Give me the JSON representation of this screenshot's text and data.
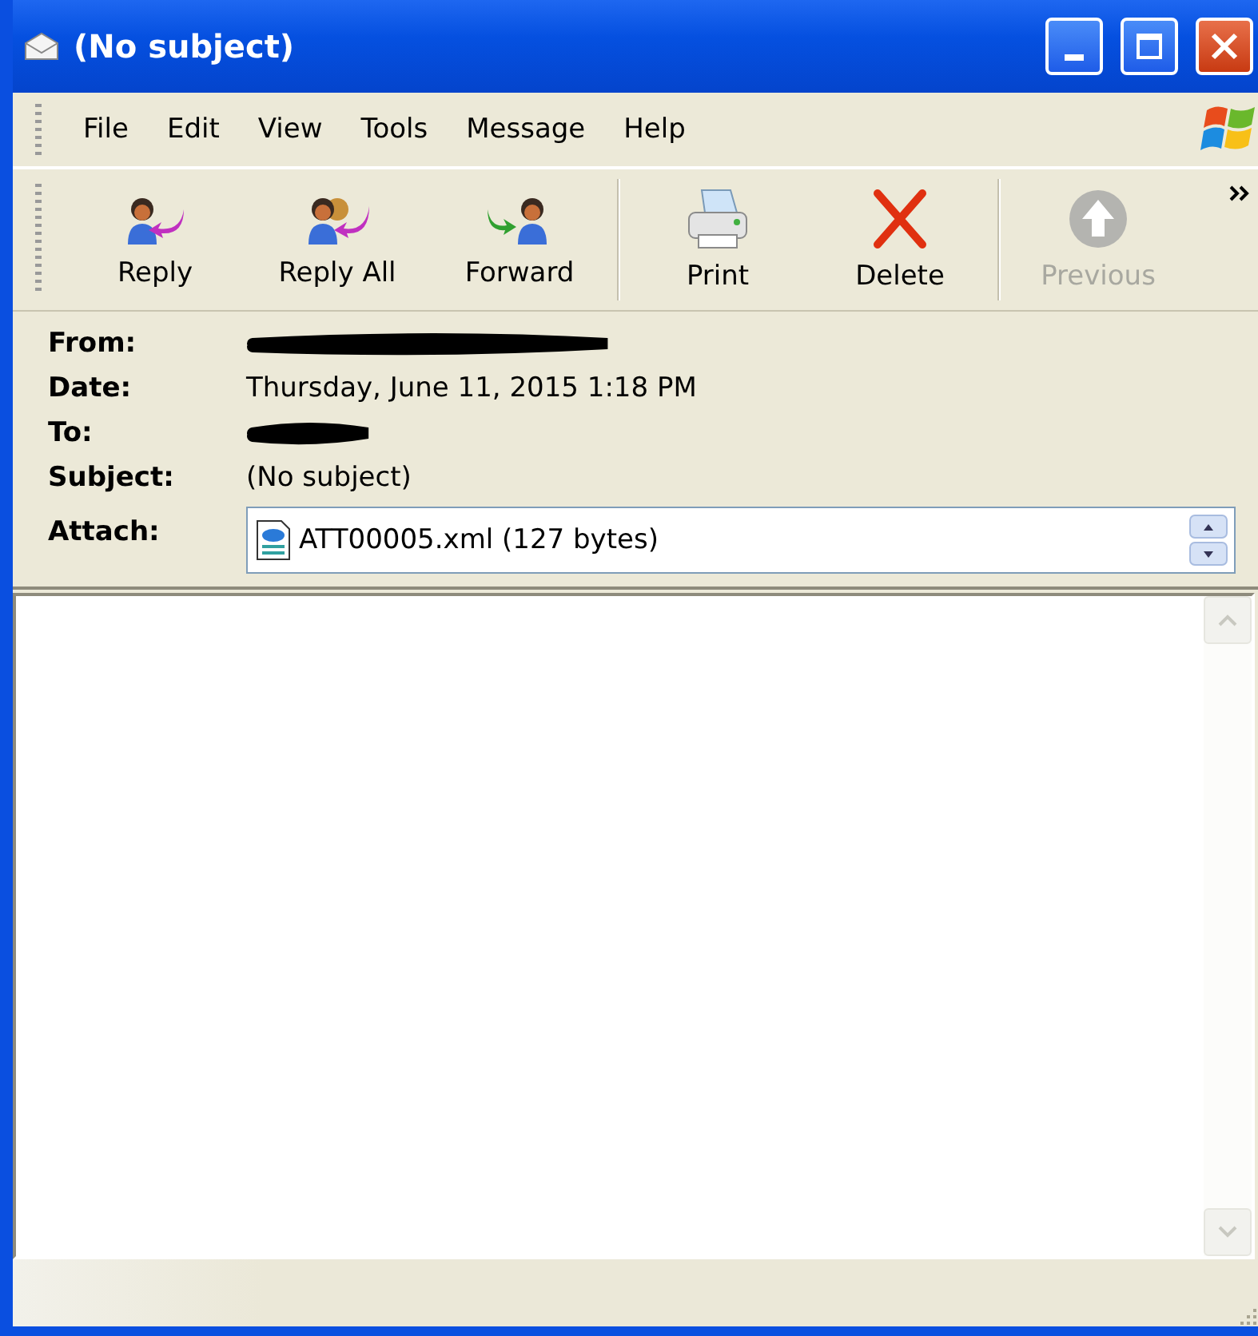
{
  "window": {
    "title": "(No subject)"
  },
  "menu": [
    "File",
    "Edit",
    "View",
    "Tools",
    "Message",
    "Help"
  ],
  "toolbar": [
    {
      "label": "Reply",
      "kind": "reply",
      "disabled": false
    },
    {
      "label": "Reply All",
      "kind": "replyall",
      "disabled": false
    },
    {
      "label": "Forward",
      "kind": "forward",
      "disabled": false
    },
    {
      "label": "Print",
      "kind": "print",
      "disabled": false,
      "separator_before": true
    },
    {
      "label": "Delete",
      "kind": "delete",
      "disabled": false
    },
    {
      "label": "Previous",
      "kind": "previous",
      "disabled": true,
      "separator_before": true
    }
  ],
  "headers": [
    {
      "label": "From:",
      "redacted": true
    },
    {
      "label": "Date:",
      "value": "Thursday, June 11, 2015 1:18 PM",
      "redacted": false
    },
    {
      "label": "To:",
      "redacted": true
    },
    {
      "label": "Subject:",
      "value": "(No subject)",
      "redacted": false
    }
  ],
  "attachment": {
    "label": "Attach:",
    "file": "ATT00005.xml (127 bytes)"
  }
}
